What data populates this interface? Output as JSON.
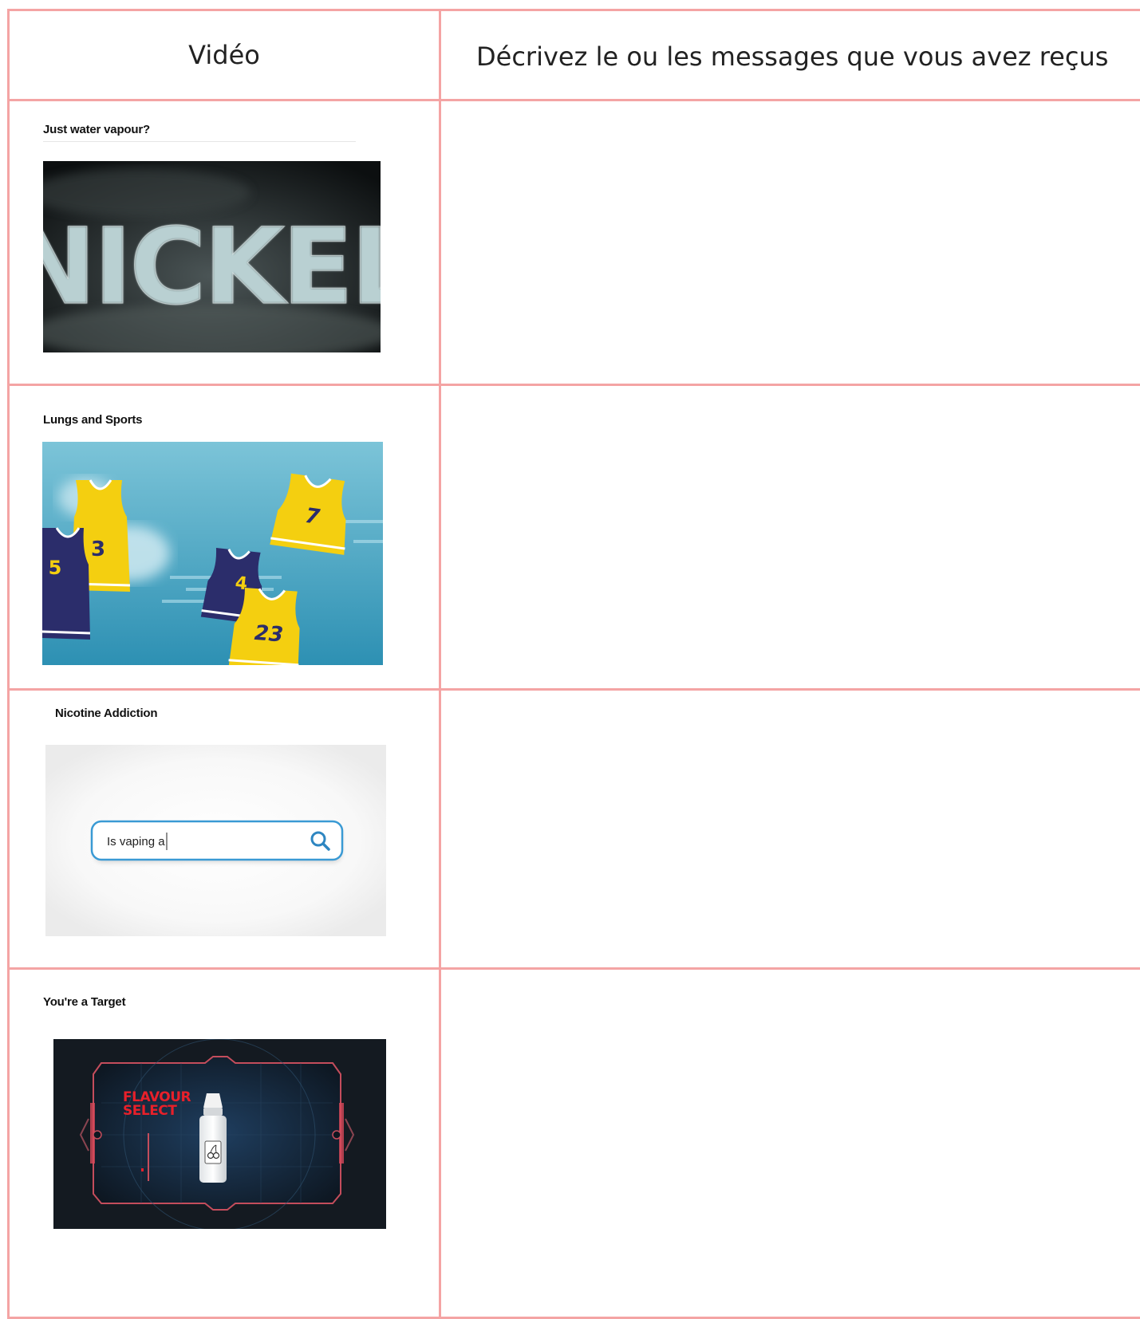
{
  "table": {
    "headers": [
      "Vidéo",
      "Décrivez le ou les messages que vous avez reçus"
    ],
    "rows": [
      {
        "title": "Just water vapour?",
        "image_text": "NICKEL",
        "response": ""
      },
      {
        "title": "Lungs and Sports",
        "jersey_numbers": [
          "3",
          "7",
          "5",
          "4",
          "23"
        ],
        "response": ""
      },
      {
        "title": "Nicotine Addiction",
        "search_text": "Is vaping a",
        "response": ""
      },
      {
        "title": "You're a Target",
        "image_text": [
          "FLAVOUR",
          "SELECT"
        ],
        "response": ""
      }
    ]
  },
  "colors": {
    "border": "#f4a4a4",
    "jersey_yellow": "#f4cf10",
    "jersey_navy": "#2b2d6b",
    "search_blue": "#3a9ad4",
    "flavour_red": "#e8202a"
  }
}
